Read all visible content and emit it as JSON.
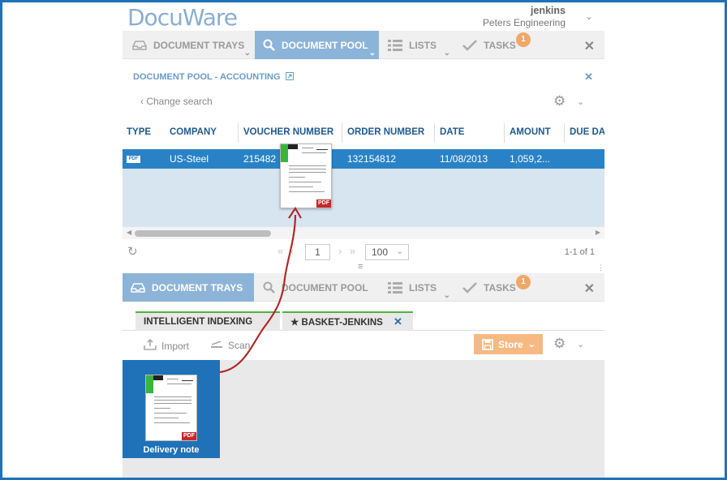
{
  "header": {
    "logo": "DocuWare",
    "user_name": "jenkins",
    "organization": "Peters Engineering"
  },
  "top_tabs": [
    {
      "label": "DOCUMENT TRAYS"
    },
    {
      "label": "DOCUMENT POOL"
    },
    {
      "label": "LISTS"
    },
    {
      "label": "TASKS",
      "badge": "1"
    }
  ],
  "pool": {
    "title": "DOCUMENT POOL - ACCOUNTING",
    "change_search": "Change search",
    "columns": [
      "TYPE",
      "COMPANY",
      "VOUCHER NUMBER",
      "ORDER NUMBER",
      "DATE",
      "AMOUNT",
      "DUE DA"
    ],
    "rows": [
      {
        "type": "PDF",
        "company": "US-Steel",
        "voucher": "215482",
        "order": "132154812",
        "date": "11/08/2013",
        "amount": "1,059,2..."
      }
    ],
    "pager": {
      "page": "1",
      "page_size": "100",
      "count": "1-1 of 1"
    }
  },
  "bottom_tabs": [
    {
      "label": "DOCUMENT TRAYS"
    },
    {
      "label": "DOCUMENT POOL"
    },
    {
      "label": "LISTS"
    },
    {
      "label": "TASKS",
      "badge": "1"
    }
  ],
  "trays": {
    "subtabs": [
      {
        "label": "INTELLIGENT INDEXING"
      },
      {
        "label": "BASKET-JENKINS"
      }
    ],
    "import_label": "Import",
    "scan_label": "Scan",
    "store_label": "Store",
    "document": {
      "label": "Delivery note",
      "badge": "PDF"
    }
  },
  "thumb_badge": "PDF",
  "colors": {
    "accent_blue": "#1f72b8",
    "active_tab": "#8cb4d8",
    "selected_row": "#2a82c6",
    "store_button": "#f6b982",
    "badge": "#f0a868",
    "drag_arrow": "#b02a2a"
  }
}
